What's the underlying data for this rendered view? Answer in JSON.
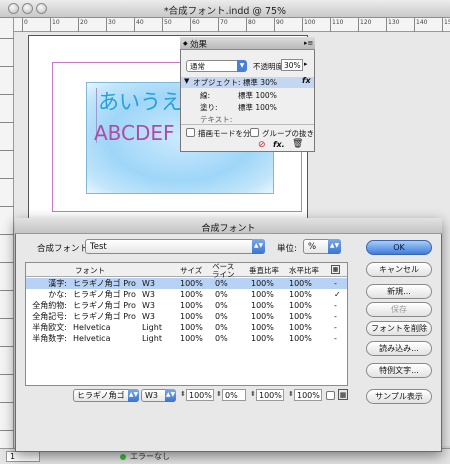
{
  "document": {
    "title": "*合成フォント.indd @ 75%",
    "ruler_numbers": [
      "0",
      "10",
      "20",
      "30",
      "40",
      "50",
      "60",
      "70",
      "80",
      "90",
      "100",
      "110",
      "120",
      "130",
      "140",
      "150"
    ],
    "sample_text_kana": "あいうえ",
    "sample_text_latin": "ABCDEF",
    "page_number": "1",
    "status": "エラーなし"
  },
  "effects_panel": {
    "title": "効果",
    "blend_mode": "通常",
    "opacity_label": "不透明度:",
    "opacity_value": "30%",
    "object_row": "オブジェクト: 標準 30%",
    "items": [
      {
        "label": "線:",
        "value": "標準 100%"
      },
      {
        "label": "塗り:",
        "value": "標準 100%"
      },
      {
        "label": "テキスト:",
        "value": ""
      }
    ],
    "isolate_blend_label": "描画モードを分離",
    "knockout_group_label": "グループの抜き",
    "fx_icon": "fx"
  },
  "dialog": {
    "title": "合成フォント",
    "font_label": "合成フォント:",
    "font_value": "Test",
    "unit_label": "単位:",
    "unit_value": "%",
    "columns": [
      "フォント",
      "サイズ",
      "ベース\nライン",
      "垂直比率",
      "水平比率"
    ],
    "rows": [
      {
        "type": "漢字:",
        "font": "ヒラギノ角ゴ Pro",
        "weight": "W3",
        "size": "100%",
        "baseline": "0%",
        "vscale": "100%",
        "hscale": "100%",
        "mark": "-",
        "selected": true
      },
      {
        "type": "かな:",
        "font": "ヒラギノ角ゴ Pro",
        "weight": "W3",
        "size": "100%",
        "baseline": "0%",
        "vscale": "100%",
        "hscale": "100%",
        "mark": "✓",
        "selected": false
      },
      {
        "type": "全角約物:",
        "font": "ヒラギノ角ゴ Pro",
        "weight": "W3",
        "size": "100%",
        "baseline": "0%",
        "vscale": "100%",
        "hscale": "100%",
        "mark": "-",
        "selected": false
      },
      {
        "type": "全角記号:",
        "font": "ヒラギノ角ゴ Pro",
        "weight": "W3",
        "size": "100%",
        "baseline": "0%",
        "vscale": "100%",
        "hscale": "100%",
        "mark": "-",
        "selected": false
      },
      {
        "type": "半角欧文:",
        "font": "Helvetica",
        "weight": "Light",
        "size": "100%",
        "baseline": "0%",
        "vscale": "100%",
        "hscale": "100%",
        "mark": "-",
        "selected": false
      },
      {
        "type": "半角数字:",
        "font": "Helvetica",
        "weight": "Light",
        "size": "100%",
        "baseline": "0%",
        "vscale": "100%",
        "hscale": "100%",
        "mark": "-",
        "selected": false
      }
    ],
    "editor": {
      "font": "ヒラギノ角ゴ P",
      "weight": "W3",
      "size": "100%",
      "baseline": "0%",
      "vscale": "100%",
      "hscale": "100%"
    },
    "buttons": {
      "ok": "OK",
      "cancel": "キャンセル",
      "new": "新規...",
      "save": "保存",
      "delete": "フォントを削除",
      "load": "読み込み...",
      "special": "特例文字...",
      "sample": "サンプル表示"
    }
  }
}
